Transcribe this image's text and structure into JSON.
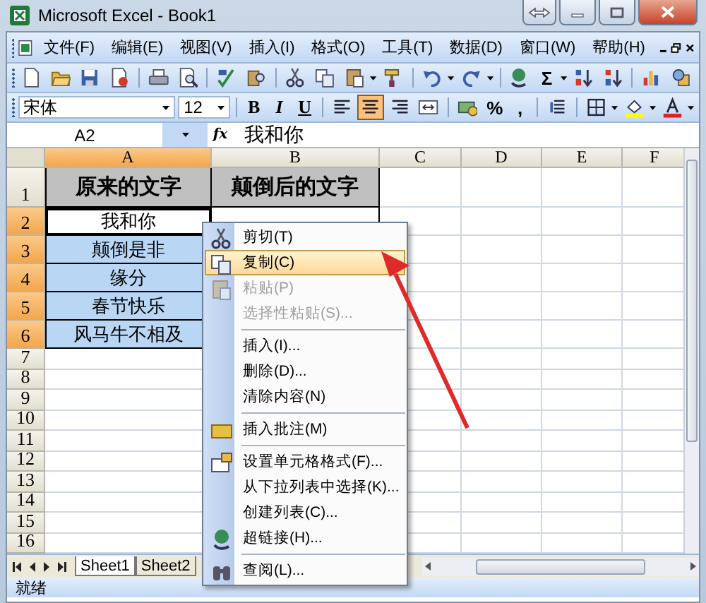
{
  "window": {
    "title": "Microsoft Excel - Book1"
  },
  "menu_bar": [
    {
      "label": "文件(F)"
    },
    {
      "label": "编辑(E)"
    },
    {
      "label": "视图(V)"
    },
    {
      "label": "插入(I)"
    },
    {
      "label": "格式(O)"
    },
    {
      "label": "工具(T)"
    },
    {
      "label": "数据(D)"
    },
    {
      "label": "窗口(W)"
    },
    {
      "label": "帮助(H)"
    }
  ],
  "standard_toolbar": {
    "sum_label": "Σ"
  },
  "format_toolbar": {
    "font": "宋体",
    "size": "12",
    "style_buttons": [
      "B",
      "I",
      "U"
    ],
    "alignment": [
      {
        "selected": false
      },
      {
        "selected": true
      },
      {
        "selected": false
      }
    ],
    "percent": "%",
    "comma": ","
  },
  "formula_bar": {
    "name_box": "A2",
    "fx": "fx",
    "formula": "我和你"
  },
  "sheet": {
    "columns": [
      {
        "label": "A",
        "selected": true
      },
      {
        "label": "B",
        "selected": false
      },
      {
        "label": "C",
        "selected": false
      },
      {
        "label": "D",
        "selected": false
      },
      {
        "label": "E",
        "selected": false
      },
      {
        "label": "F",
        "selected": false
      }
    ],
    "rows": [
      {
        "label": "1",
        "selected": false,
        "cells": [
          {
            "text": "原来的文字",
            "kind": "header"
          },
          {
            "text": "颠倒后的文字",
            "kind": "header"
          }
        ]
      },
      {
        "label": "2",
        "selected": true,
        "cells": [
          {
            "text": "我和你",
            "kind": "data",
            "active": true
          },
          {
            "kind": "data"
          }
        ]
      },
      {
        "label": "3",
        "selected": true,
        "cells": [
          {
            "text": "颠倒是非",
            "kind": "data",
            "selected": true,
            "active": false
          }
        ]
      },
      {
        "label": "4",
        "selected": true,
        "cells": [
          {
            "text": "缘分",
            "kind": "data",
            "selected": true,
            "active": false
          }
        ]
      },
      {
        "label": "5",
        "selected": true,
        "cells": [
          {
            "text": "春节快乐",
            "kind": "data",
            "selected": true,
            "active": false
          }
        ]
      },
      {
        "label": "6",
        "selected": true,
        "cells": [
          {
            "text": "风马牛不相及",
            "kind": "data",
            "selected": true,
            "active": false
          }
        ]
      },
      {
        "label": "7",
        "selected": false
      },
      {
        "label": "8",
        "selected": false
      },
      {
        "label": "9",
        "selected": false
      },
      {
        "label": "10",
        "selected": false
      },
      {
        "label": "11",
        "selected": false
      },
      {
        "label": "12",
        "selected": false
      },
      {
        "label": "13",
        "selected": false
      },
      {
        "label": "14",
        "selected": false
      },
      {
        "label": "15",
        "selected": false
      },
      {
        "label": "16",
        "selected": false
      }
    ]
  },
  "sheet_tabs": [
    {
      "label": "Sheet1",
      "selected": true
    },
    {
      "label": "Sheet2",
      "selected": false
    }
  ],
  "status_bar": {
    "text": "就绪"
  },
  "context_menu": [
    {
      "kind": "item",
      "label": "剪切(T)",
      "disabled": false,
      "selected": false
    },
    {
      "kind": "item",
      "label": "复制(C)",
      "disabled": false,
      "selected": true
    },
    {
      "kind": "item",
      "label": "粘贴(P)",
      "disabled": true,
      "selected": false
    },
    {
      "kind": "item",
      "label": "选择性粘贴(S)...",
      "disabled": true,
      "selected": false
    },
    {
      "kind": "separator"
    },
    {
      "kind": "item",
      "label": "插入(I)...",
      "disabled": false,
      "selected": false
    },
    {
      "kind": "item",
      "label": "删除(D)...",
      "disabled": false,
      "selected": false
    },
    {
      "kind": "item",
      "label": "清除内容(N)",
      "disabled": false,
      "selected": false
    },
    {
      "kind": "separator"
    },
    {
      "kind": "item",
      "label": "插入批注(M)",
      "disabled": false,
      "selected": false
    },
    {
      "kind": "separator"
    },
    {
      "kind": "item",
      "label": "设置单元格格式(F)...",
      "disabled": false,
      "selected": false
    },
    {
      "kind": "item",
      "label": "从下拉列表中选择(K)...",
      "disabled": false,
      "selected": false
    },
    {
      "kind": "item",
      "label": "创建列表(C)...",
      "disabled": false,
      "selected": false
    },
    {
      "kind": "item",
      "label": "超链接(H)...",
      "disabled": false,
      "selected": false
    },
    {
      "kind": "separator"
    },
    {
      "kind": "item",
      "label": "查阅(L)...",
      "disabled": false,
      "selected": false
    }
  ]
}
